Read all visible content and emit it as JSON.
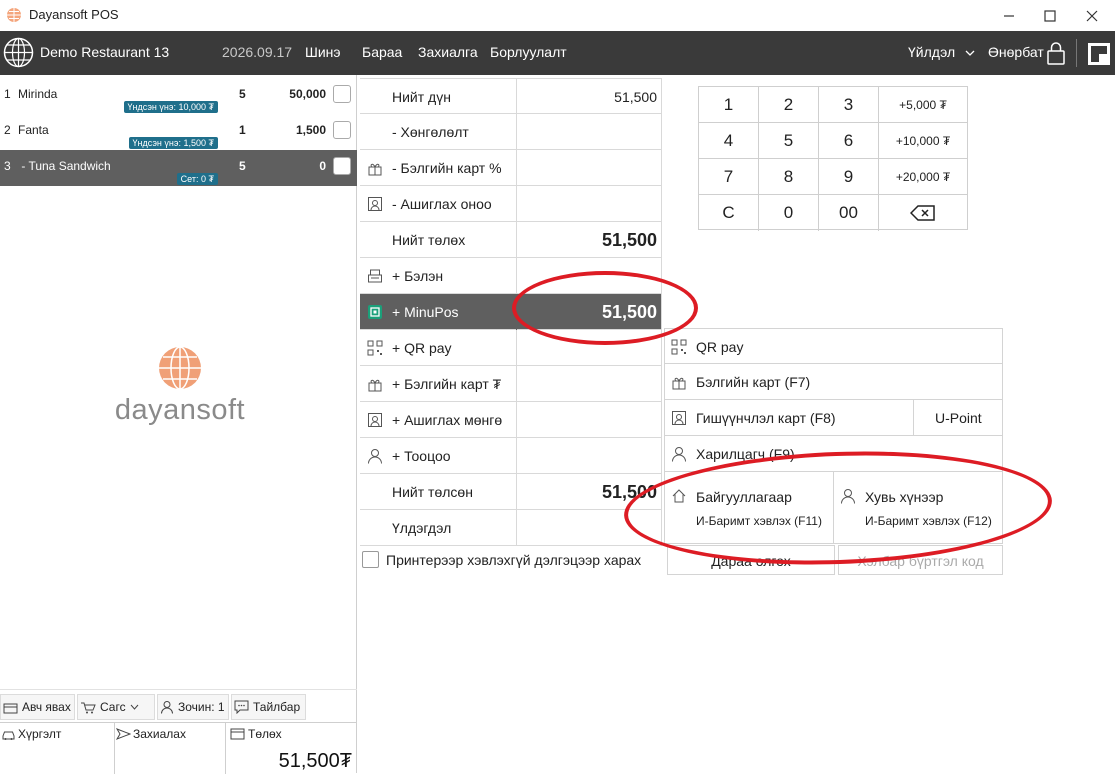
{
  "window": {
    "title": "Dayansoft POS",
    "controls": [
      "minimize",
      "maximize",
      "close"
    ]
  },
  "header": {
    "restaurant": "Demo Restaurant 13",
    "date": "2026.09.17",
    "nav": [
      "Шинэ",
      "Бараа",
      "Захиалга",
      "Борлуулалт"
    ],
    "menu_label": "Үйлдэл",
    "user_label": "Өнөрбат"
  },
  "order": {
    "items": [
      {
        "num": "1",
        "name": "Mirinda",
        "badge": "Үндсэн үнэ: 10,000 ₮",
        "qty": "5",
        "amount": "50,000"
      },
      {
        "num": "2",
        "name": "Fanta",
        "badge": "Үндсэн үнэ: 1,500 ₮",
        "qty": "1",
        "amount": "1,500"
      },
      {
        "num": "3",
        "name": " - Tuna Sandwich",
        "badge": "Сет: 0 ₮",
        "qty": "5",
        "amount": "0"
      }
    ],
    "selected_index": 2,
    "logo_text": "dayansoft",
    "tools": {
      "takeaway": "Авч явах",
      "cart": "Сагс",
      "guest": "Зочин: 1",
      "note": "Тайлбар"
    },
    "delivery": "Хүргэлт",
    "order_label": "Захиалах",
    "payment_label": "Төлөх",
    "total": "51,500₮"
  },
  "summary": [
    {
      "label": "Нийт дүн",
      "value": "51,500",
      "big": false,
      "icon": ""
    },
    {
      "label": "- Хөнгөлөлт",
      "value": "",
      "big": false,
      "icon": ""
    },
    {
      "label": "- Бэлгийн карт %",
      "value": "",
      "big": false,
      "icon": "gift-icon"
    },
    {
      "label": "- Ашиглах оноо",
      "value": "",
      "big": false,
      "icon": "points-icon"
    },
    {
      "label": "Нийт төлөх",
      "value": "51,500",
      "big": true,
      "icon": ""
    },
    {
      "label": "+ Бэлэн",
      "value": "",
      "big": false,
      "icon": "cash-register-icon"
    },
    {
      "label": "+ MinuPos",
      "value": "51,500",
      "big": true,
      "icon": "minupos-icon",
      "active": true
    },
    {
      "label": "+ QR pay",
      "value": "",
      "big": false,
      "icon": "qr-icon"
    },
    {
      "label": "+ Бэлгийн карт ₮",
      "value": "",
      "big": false,
      "icon": "gift-icon"
    },
    {
      "label": "+ Ашиглах мөнгө",
      "value": "",
      "big": false,
      "icon": "points-icon"
    },
    {
      "label": "+ Тооцоо",
      "value": "",
      "big": false,
      "icon": "person-icon"
    },
    {
      "label": "Нийт төлсөн",
      "value": "51,500",
      "big": true,
      "icon": ""
    },
    {
      "label": "Үлдэгдэл",
      "value": "",
      "big": false,
      "icon": ""
    }
  ],
  "printer_option": "Принтерээр хэвлэхгүй дэлгэцээр харах",
  "keypad": [
    [
      "1",
      "2",
      "3",
      "+5,000 ₮"
    ],
    [
      "4",
      "5",
      "6",
      "+10,000 ₮"
    ],
    [
      "7",
      "8",
      "9",
      "+20,000 ₮"
    ],
    [
      "C",
      "0",
      "00",
      "⌫"
    ]
  ],
  "payment_options": {
    "qr": "QR pay",
    "gift": "Бэлгийн карт (F7)",
    "member": "Гишүүнчлэл карт (F8)",
    "upoint": "U-Point",
    "customer": "Харилцагч (F9)",
    "org_title": "Байгууллагаар",
    "org_sub": "И-Баримт хэвлэх (F11)",
    "personal_title": "Хувь хүнээр",
    "personal_sub": "И-Баримт хэвлэх (F12)",
    "next_order": "Дараа олгох",
    "register_code": "Хэлбар бүртгэл код"
  },
  "colors": {
    "header": "#3a3a3a",
    "selected_row": "#5f5f5f",
    "badge": "#1f6f8b",
    "annotation": "#dd1c24",
    "logo": "#f0a077"
  }
}
